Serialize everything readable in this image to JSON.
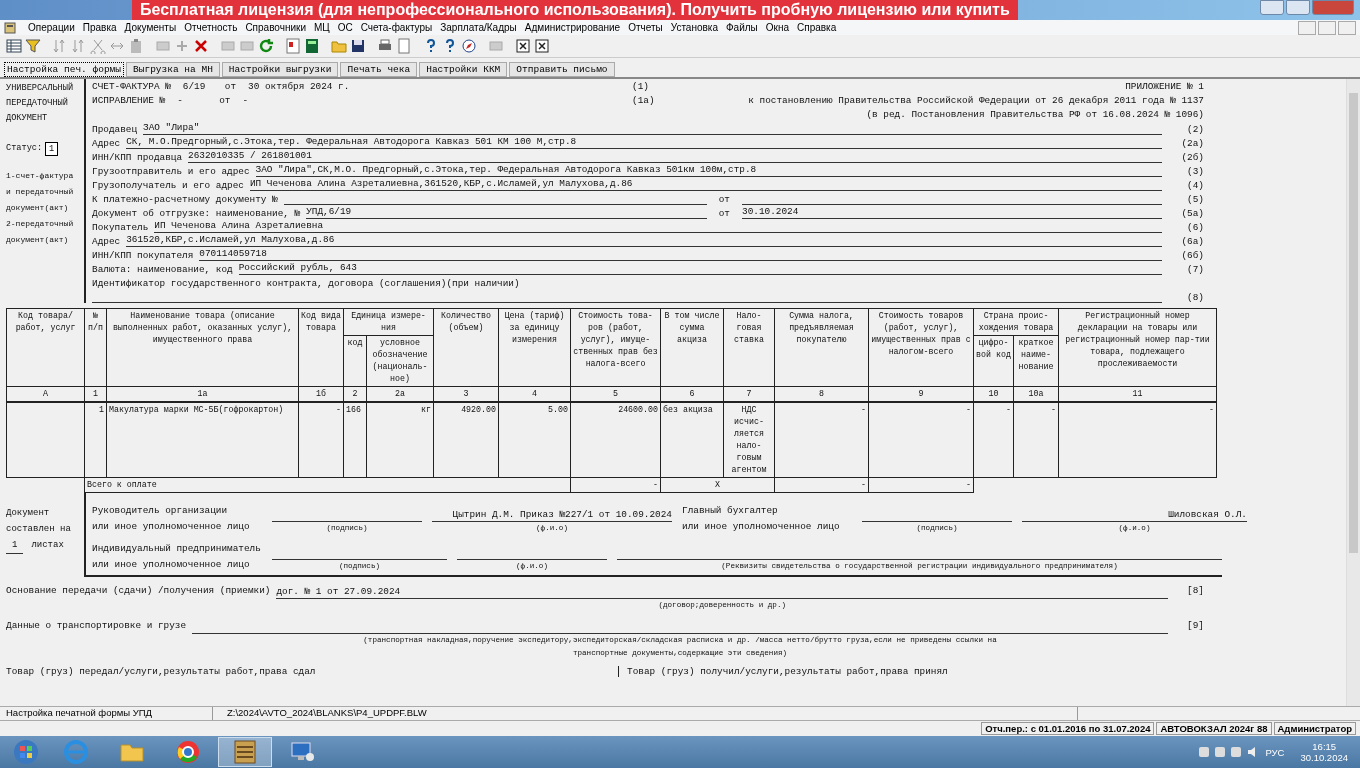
{
  "banner": "Бесплатная лицензия (для непрофессионального использования). Получить пробную лицензию или купить",
  "menu": [
    "Операции",
    "Правка",
    "Документы",
    "Отчетность",
    "Справочники",
    "МЦ",
    "ОС",
    "Счета-фактуры",
    "Зарплата/Кадры",
    "Администрирование",
    "Отчеты",
    "Установка",
    "Файлы",
    "Окна",
    "Справка"
  ],
  "form_buttons": [
    {
      "label": "Настройка печ. формы",
      "selected": true
    },
    {
      "label": "Выгрузка на МН",
      "selected": false
    },
    {
      "label": "Настройки выгрузки",
      "selected": false
    },
    {
      "label": "Печать чека",
      "selected": false
    },
    {
      "label": "Настройки ККМ",
      "selected": false
    },
    {
      "label": "Отправить письмо",
      "selected": false
    }
  ],
  "left_panel": {
    "title_lines": [
      "УНИВЕРСАЛЬНЫЙ",
      "ПЕРЕДАТОЧНЫЙ",
      "ДОКУМЕНТ"
    ],
    "status_label": "Статус:",
    "status": "1",
    "legend": [
      "1-счет-фактура",
      "и передаточный",
      "документ(акт)",
      "2-передаточный",
      "документ(акт)"
    ]
  },
  "invoice": {
    "label": "СЧЕТ-ФАКТУРА №",
    "number": "6/19",
    "date_label": "от",
    "date": "30 октября 2024 г.",
    "code": "(1)"
  },
  "correction": {
    "label": "ИСПРАВЛЕНИЕ №",
    "number": "-",
    "date_label": "от",
    "date": "-",
    "code": "(1а)"
  },
  "appendix": [
    "ПРИЛОЖЕНИЕ № 1",
    "к постановлению Правительства Российской Федерации от 26 декабря 2011 года № 1137",
    "(в ред. Постановления Правительства РФ от 16.08.2024 № 1096)"
  ],
  "fields": [
    {
      "kind": "line",
      "label": "Продавец",
      "value": "ЗАО \"Лира\"",
      "code": "(2)"
    },
    {
      "kind": "line",
      "label": "Адрес",
      "value": "СК, М.О.Предгорный,с.Этока,тер. Федеральная Автодорога Кавказ 501 КМ 100 М,стр.8",
      "code": "(2а)"
    },
    {
      "kind": "line",
      "label": "ИНН/КПП продавца",
      "value": "2632010335 / 261801001",
      "code": "(2б)"
    },
    {
      "kind": "line",
      "label": "Грузоотправитель и его адрес",
      "value": "ЗАО \"Лира\",СК,М.О. Предгорный,с.Этока,тер. Федеральная Автодорога Кавказ 501км 100м,стр.8",
      "code": "(3)"
    },
    {
      "kind": "line",
      "label": "Грузополучатель  и его адрес",
      "value": "ИП Чеченова Алина Азреталиевна,361520,КБР,с.Исламей,ул Малухова,д.86",
      "code": "(4)"
    },
    {
      "kind": "dated",
      "label": "К платежно-расчетному документу №",
      "date_label": "от",
      "code": "(5)"
    },
    {
      "kind": "dated",
      "label": "Документ об отгрузке: наименование, №",
      "value": "УПД,6/19",
      "date_label": "от",
      "date": "30.10.2024",
      "code": "(5а)"
    },
    {
      "kind": "line",
      "label": "Покупатель",
      "value": "ИП Чеченова Алина Азреталиевна",
      "code": "(6)"
    },
    {
      "kind": "line",
      "label": "Адрес",
      "value": "361520,КБР,с.Исламей,ул Малухова,д.86",
      "code": "(6а)"
    },
    {
      "kind": "line",
      "label": "ИНН/КПП покупателя",
      "value": "070114059718",
      "code": "(6б)"
    },
    {
      "kind": "line",
      "label": "Валюта: наименование, код",
      "value": "Российский рубль, 643",
      "code": "(7)"
    },
    {
      "kind": "wrapped",
      "label": "Идентификатор государственного контракта, договора (соглашения)(при наличии)",
      "code": "(8)"
    }
  ],
  "table": {
    "header_top": [
      "Код товара/ работ, услуг",
      "№ п/п",
      "Наименование товара (описание выполненных работ, оказанных услуг), имущественного права",
      "Код вида товара",
      "Единица измере-ния",
      "Количество (объем)",
      "Цена (тариф) за единицу измерения",
      "Стоимость това-ров (работ, услуг), имуще-ственных прав без налога-всего",
      "В том числе сумма акциза",
      "Нало-говая ставка",
      "Сумма налога, предъявляемая покупателю",
      "Стоимость товаров (работ, услуг), имущественных прав с налогом-всего",
      "Страна проис-хождения товара",
      "Регистрационный номер декларации на товары или регистрационный номер пар-тии товара, подлежащего прослеживаемости"
    ],
    "header_sub": [
      "код",
      "условное обозначение (националь-ное)",
      "цифро-вой код",
      "краткое наиме-нование"
    ],
    "numbers": [
      "А",
      "1",
      "1а",
      "1б",
      "2",
      "2а",
      "3",
      "4",
      "5",
      "6",
      "7",
      "8",
      "9",
      "10",
      "10а",
      "11"
    ],
    "rows": [
      {
        "cells": [
          "",
          "1",
          "Макулатура марки МС-5Б(гофрокартон)",
          "-",
          "166",
          "кг",
          "4920.00",
          "5.00",
          "24600.00",
          "без акциза",
          "НДС исчис-ляется нало-говым агентом",
          "-",
          "-",
          "-",
          "-",
          "-"
        ]
      }
    ],
    "total": {
      "label": "Всего к оплате",
      "cost": "-",
      "excise": "X",
      "tax": "-",
      "sum": "-"
    }
  },
  "signatures": {
    "doc_label": "Документ составлен на",
    "sheets": "1",
    "sheets_label": "листах",
    "head": {
      "title": [
        "Руководитель организации",
        "или иное уполномоченное лицо"
      ],
      "name": "Цытрин Д.М. Приказ №227/1 от 10.09.2024",
      "captions": [
        "(подпись)",
        "(ф.и.о)"
      ]
    },
    "accountant": {
      "title": [
        "Главный бухгалтер",
        "или иное уполномоченное лицо"
      ],
      "name": "Шиловская О.Л.",
      "captions": [
        "(подпись)",
        "(ф.и.о)"
      ]
    },
    "entrepreneur": {
      "title": [
        "Индивидуальный предприниматель",
        "или иное уполномоченное лицо"
      ],
      "captions": [
        "(подпись)",
        "(ф.и.о)",
        "(Реквизиты свидетельства о государственной регистрации индивидуального предпринимателя)"
      ]
    }
  },
  "basis": {
    "label": "Основание передачи (сдачи) /получения (приемки)",
    "value": "дог. № 1 от 27.09.2024",
    "code": "[8]",
    "caption": "(договор;доверенность и др.)"
  },
  "transport": {
    "label": "Данные о транспортировке и грузе",
    "code": "[9]",
    "caption": "(транспортная накладная,поручение экспедитору,экспедиторская/складская расписка и др. /масса нетто/брутто груза,если не приведены ссылки на транспортные документы,содержащие эти сведения)"
  },
  "handover": [
    "Товар (груз) передал/услуги,результаты работ,права сдал",
    "Товар (груз) получил/услуги,результаты работ,права принял"
  ],
  "status_bar": [
    "Настройка печатной формы УПД",
    "Z:\\2024\\AVTO_2024\\BLANKS\\P4_UPDPF.BLW"
  ],
  "info_bar": [
    "Отч.пер.: с 01.01.2016 по 31.07.2024",
    "АВТОВОКЗАЛ 2024г 88",
    "Администратор"
  ],
  "taskbar": {
    "language": "РУС",
    "time": "16:15",
    "date": "30.10.2024"
  }
}
